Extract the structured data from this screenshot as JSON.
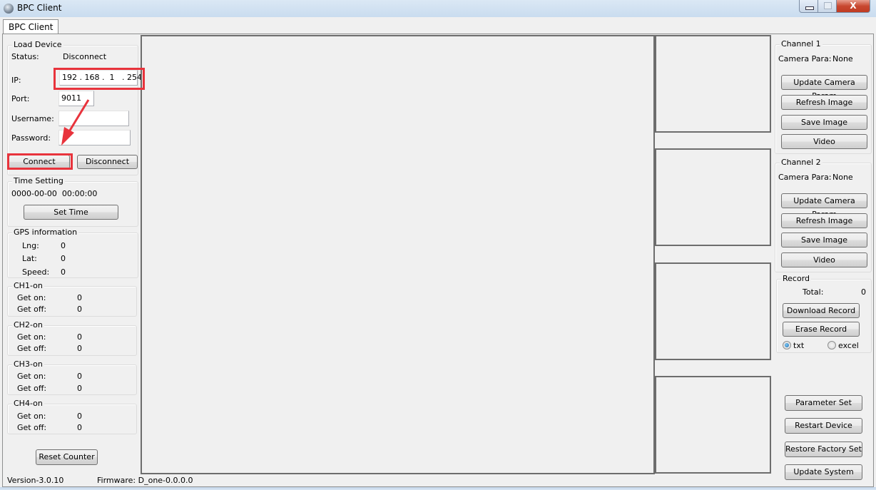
{
  "window": {
    "title": "BPC Client",
    "buttons": {
      "minimize": "minimize",
      "maximize": "maximize",
      "close": "X"
    }
  },
  "tabs": [
    {
      "label": "BPC Client",
      "active": true
    }
  ],
  "load_device": {
    "group_label": "Load Device",
    "status_label": "Status:",
    "status_value": "Disconnect",
    "ip_label": "IP:",
    "ip_value": "192 . 168 .  1   . 254",
    "port_label": "Port:",
    "port_value": "9011",
    "username_label": "Username:",
    "username_value": "",
    "password_label": "Password:",
    "password_value": "",
    "connect_label": "Connect",
    "disconnect_label": "Disconnect"
  },
  "time_setting": {
    "group_label": "Time Setting",
    "value": "0000-00-00  00:00:00",
    "set_time_label": "Set Time"
  },
  "gps": {
    "group_label": "GPS information",
    "lng_label": "Lng:",
    "lng_value": "0",
    "lat_label": "Lat:",
    "lat_value": "0",
    "speed_label": "Speed:",
    "speed_value": "0"
  },
  "counters": [
    {
      "label": "CH1-on",
      "get_on_label": "Get on:",
      "get_on": "0",
      "get_off_label": "Get off:",
      "get_off": "0"
    },
    {
      "label": "CH2-on",
      "get_on_label": "Get on:",
      "get_on": "0",
      "get_off_label": "Get off:",
      "get_off": "0"
    },
    {
      "label": "CH3-on",
      "get_on_label": "Get on:",
      "get_on": "0",
      "get_off_label": "Get off:",
      "get_off": "0"
    },
    {
      "label": "CH4-on",
      "get_on_label": "Get on:",
      "get_on": "0",
      "get_off_label": "Get off:",
      "get_off": "0"
    }
  ],
  "reset_counter_label": "Reset Counter",
  "footer": {
    "version": "Version-3.0.10",
    "firmware": "Firmware: D_one-0.0.0.0"
  },
  "channels": [
    {
      "group_label": "Channel 1",
      "camera_para_label": "Camera Para:",
      "camera_para_value": "None",
      "update_label": "Update Camera Param",
      "refresh_label": "Refresh Image",
      "save_label": "Save Image",
      "video_label": "Video"
    },
    {
      "group_label": "Channel 2",
      "camera_para_label": "Camera Para:",
      "camera_para_value": "None",
      "update_label": "Update Camera Param",
      "refresh_label": "Refresh Image",
      "save_label": "Save Image",
      "video_label": "Video"
    }
  ],
  "record": {
    "group_label": "Record",
    "total_label": "Total:",
    "total_value": "0",
    "download_label": "Download Record",
    "erase_label": "Erase Record",
    "format_options": [
      {
        "label": "txt",
        "checked": true
      },
      {
        "label": "excel",
        "checked": false
      }
    ]
  },
  "system_buttons": {
    "parameter_set": "Parameter Set",
    "restart_device": "Restart Device",
    "restore_factory": "Restore Factory Set",
    "update_system": "Update System"
  },
  "annotation": {
    "highlight_color": "#e8333c"
  }
}
